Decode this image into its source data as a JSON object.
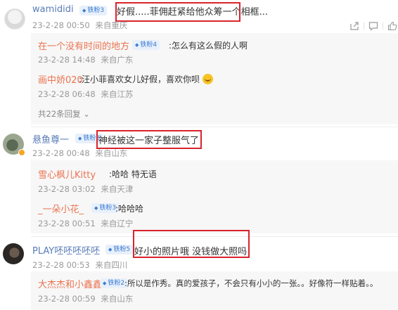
{
  "comments": [
    {
      "user": "wamididi",
      "rank": "铁粉3",
      "text": "好假.....菲佣赶紧给他众筹一个相框...",
      "time": "23-2-28 00:50",
      "location": "来自重庆",
      "replies": [
        {
          "user": "在一个没有时间的地方",
          "rank": "铁粉4",
          "text": ":怎么有这么假的人啊",
          "time": "23-2-28 14:48",
          "location": "来自广东"
        },
        {
          "user": "画中娇020",
          "text": ":汪小菲喜欢女儿好假，喜欢你呗",
          "time": "23-2-28 06:48",
          "location": "来自江苏"
        }
      ],
      "more": "共22条回复"
    },
    {
      "user": "悬鱼尊一",
      "rank": "铁粉3",
      "text": "神经被这一家子整服气了",
      "time": "23-2-28 00:48",
      "location": "来自山东",
      "replies": [
        {
          "user": "雪心枫儿Kitty",
          "text": ":哈哈   特无语",
          "time": "23-2-28 03:02",
          "location": "来自天津"
        },
        {
          "user": "_一朵小花_",
          "rank": "铁粉3",
          "text": ":哈哈哈",
          "time": "23-2-28 00:51",
          "location": "来自辽宁"
        }
      ]
    },
    {
      "user": "PLAY呸呸呸呸呸",
      "rank": "铁粉5",
      "text": "好小的照片哦   没钱做大照吗",
      "time": "23-2-28 00:53",
      "location": "来自四川",
      "replies": [
        {
          "user": "大杰杰和小鑫鑫",
          "rank": "铁粉2",
          "text": ":所以是作秀。真的爱孩子，不会只有小小的一张。。好像符一样贴着。。",
          "time": "23-2-28 00:59",
          "location": "来自山东"
        }
      ]
    }
  ],
  "icons": [
    "share-icon",
    "comment-icon",
    "like-icon"
  ],
  "colors": {
    "username": "#eb7350",
    "reply_username": "#eb7350",
    "highlight": "#d9232c",
    "meta": "#9a9a9a"
  }
}
